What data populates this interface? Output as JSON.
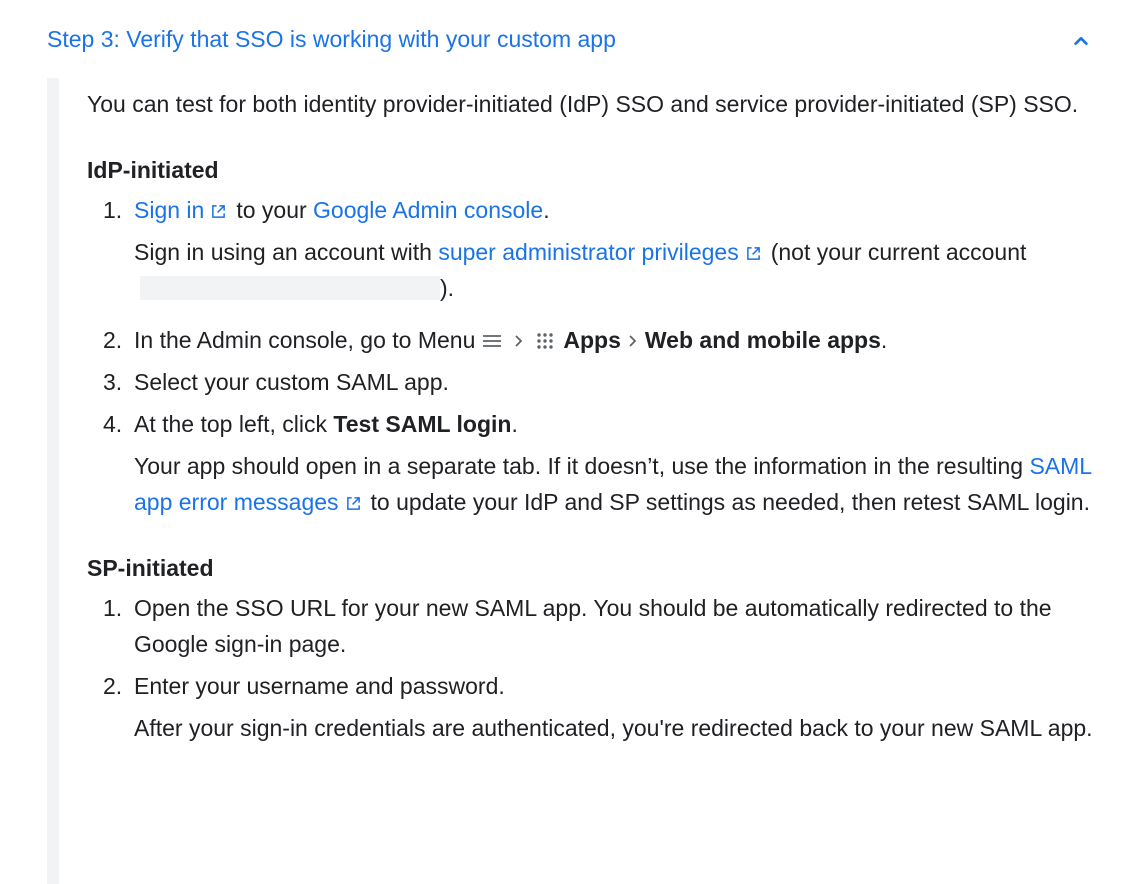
{
  "header": {
    "title": "Step 3: Verify that SSO is working with your custom app",
    "collapse_icon": "chevron-up-icon"
  },
  "intro": "You can test for both identity provider-initiated (IdP) SSO and service provider-initiated (SP) SSO.",
  "idp": {
    "title": "IdP-initiated",
    "step1": {
      "num": "1.",
      "link1": "Sign in",
      "text1": "to your",
      "link2": "Google Admin console",
      "text2": ".",
      "sub_text1": "Sign in using an account with",
      "sub_link": "super administrator privileges",
      "sub_text2": "(not your current account",
      "sub_text3": ")."
    },
    "step2": {
      "num": "2.",
      "text1": "In the Admin console, go to Menu",
      "bold1": "Apps",
      "bold2": "Web and mobile apps",
      "text2": "."
    },
    "step3": {
      "num": "3.",
      "text": "Select your custom SAML app."
    },
    "step4": {
      "num": "4.",
      "text1": "At the top left, click",
      "bold": "Test SAML login",
      "text2": ".",
      "sub_text1": "Your app should open in a separate tab. If it doesn’t, use the information in the resulting",
      "sub_link": "SAML app error messages",
      "sub_text2": "to update your IdP and SP settings as needed, then retest SAML login."
    }
  },
  "sp": {
    "title": "SP-initiated",
    "step1": {
      "num": "1.",
      "text": "Open the SSO URL for your new SAML app. You should be automatically redirected to the Google sign-in page."
    },
    "step2": {
      "num": "2.",
      "text": "Enter your username and password.",
      "sub_text": "After your sign-in credentials are authenticated, you're redirected back to your new SAML app."
    }
  },
  "colors": {
    "link": "#1a73e8",
    "text": "#202124",
    "panel_border": "#f1f3f4"
  }
}
